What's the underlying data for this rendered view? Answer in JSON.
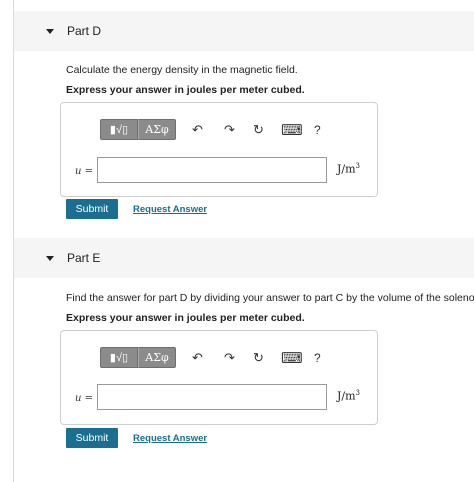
{
  "partD": {
    "title": "Part D",
    "prompt": "Calculate the energy density in the magnetic field.",
    "instruction": "Express your answer in joules per meter cubed.",
    "var_label": "u =",
    "input_value": "",
    "unit_base": "J/m",
    "unit_exp": "3",
    "submit_label": "Submit",
    "request_label": "Request Answer"
  },
  "partE": {
    "title": "Part E",
    "prompt": "Find the answer for part D by dividing your answer to part C by the volume of the solenoid.",
    "instruction": "Express your answer in joules per meter cubed.",
    "var_label": "u =",
    "input_value": "",
    "unit_base": "J/m",
    "unit_exp": "3",
    "submit_label": "Submit",
    "request_label": "Request Answer"
  },
  "toolbar": {
    "templates_label": "▮√▯",
    "greek_label": "ΑΣφ",
    "undo_glyph": "↶",
    "redo_glyph": "↷",
    "reset_glyph": "↻",
    "keyboard_glyph": "⌨",
    "help_glyph": "?"
  }
}
